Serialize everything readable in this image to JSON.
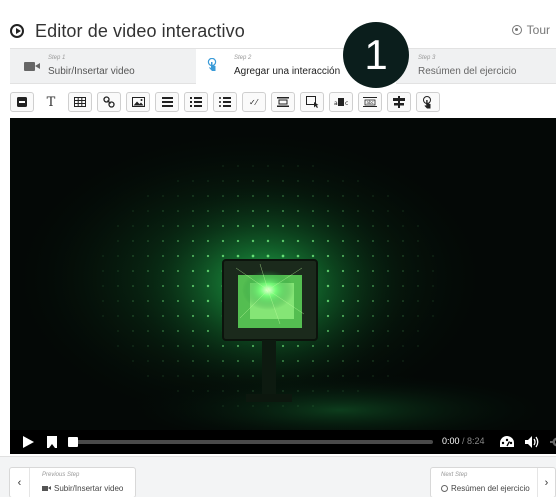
{
  "header": {
    "title": "Editor de video interactivo",
    "tour_label": "Tour"
  },
  "steps": [
    {
      "small": "Step 1",
      "label": "Subir/Insertar video"
    },
    {
      "small": "Step 2",
      "label": "Agregar una interacción"
    },
    {
      "small": "Step 3",
      "label": "Resúmen del ejercicio"
    }
  ],
  "badge": "1",
  "toolbar": {
    "tools": [
      "label",
      "text",
      "table",
      "link",
      "image",
      "statements",
      "single-choice-set",
      "multiple-choice",
      "true-false",
      "fill-in-the-blanks",
      "drag-and-drop",
      "mark-the-words",
      "drag-text",
      "crossroads",
      "navigation-hotspot"
    ]
  },
  "player": {
    "current_time": "0:00",
    "separator": " / ",
    "total_time": "8:24",
    "progress": 0.0
  },
  "footer": {
    "prev_small": "Previous Step",
    "prev_label": "Subir/Insertar video",
    "next_small": "Next Step",
    "next_label": "Resúmen del ejercicio"
  },
  "colors": {
    "laser": "#3dff6a",
    "badge_bg": "#0b1e1c"
  }
}
